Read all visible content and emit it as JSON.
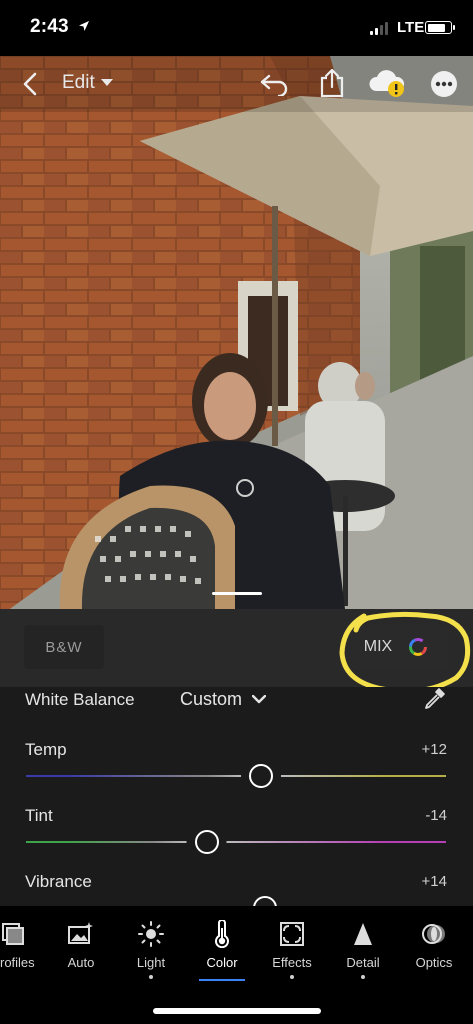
{
  "status_bar": {
    "time": "2:43",
    "network": "LTE",
    "icons": [
      "location-arrow-icon",
      "signal-bars-icon",
      "battery-icon"
    ]
  },
  "toolbar": {
    "edit_label": "Edit",
    "icons": [
      "back-chevron-icon",
      "chevron-down-icon",
      "undo-icon",
      "share-icon",
      "cloud-warning-icon",
      "more-options-icon"
    ]
  },
  "mode_toggle": {
    "bw_label": "B&W",
    "mix_label": "MIX",
    "mix_icon": "color-wheel-icon",
    "annotation_color": "#f4e04a"
  },
  "panel": {
    "white_balance": {
      "label": "White Balance",
      "value": "Custom",
      "icon": "eyedropper-icon"
    },
    "sliders": [
      {
        "label": "Temp",
        "value": "+12",
        "level": 0.56,
        "colors": [
          "#3a3aa8",
          "#b6b04a"
        ]
      },
      {
        "label": "Tint",
        "value": "-14",
        "level": 0.43,
        "colors": [
          "#3fa34a",
          "#b63fb6"
        ]
      },
      {
        "label": "Vibrance",
        "value": "+14",
        "level": 0.57,
        "colors": [
          "#666666",
          "#666666"
        ]
      }
    ]
  },
  "tabs": [
    {
      "label": "Profiles",
      "icon": "profiles-icon",
      "dot": false
    },
    {
      "label": "Auto",
      "icon": "auto-magic-icon",
      "dot": false
    },
    {
      "label": "Light",
      "icon": "sun-icon",
      "dot": true
    },
    {
      "label": "Color",
      "icon": "thermometer-icon",
      "dot": false,
      "active": true
    },
    {
      "label": "Effects",
      "icon": "effects-icon",
      "dot": true
    },
    {
      "label": "Detail",
      "icon": "detail-triangle-icon",
      "dot": true
    },
    {
      "label": "Optics",
      "icon": "optics-lens-icon",
      "dot": false
    }
  ],
  "colors": {
    "accent": "#3b82f6",
    "panel_bg": "#1b1b1b",
    "mode_bg": "#2d2d2d"
  }
}
